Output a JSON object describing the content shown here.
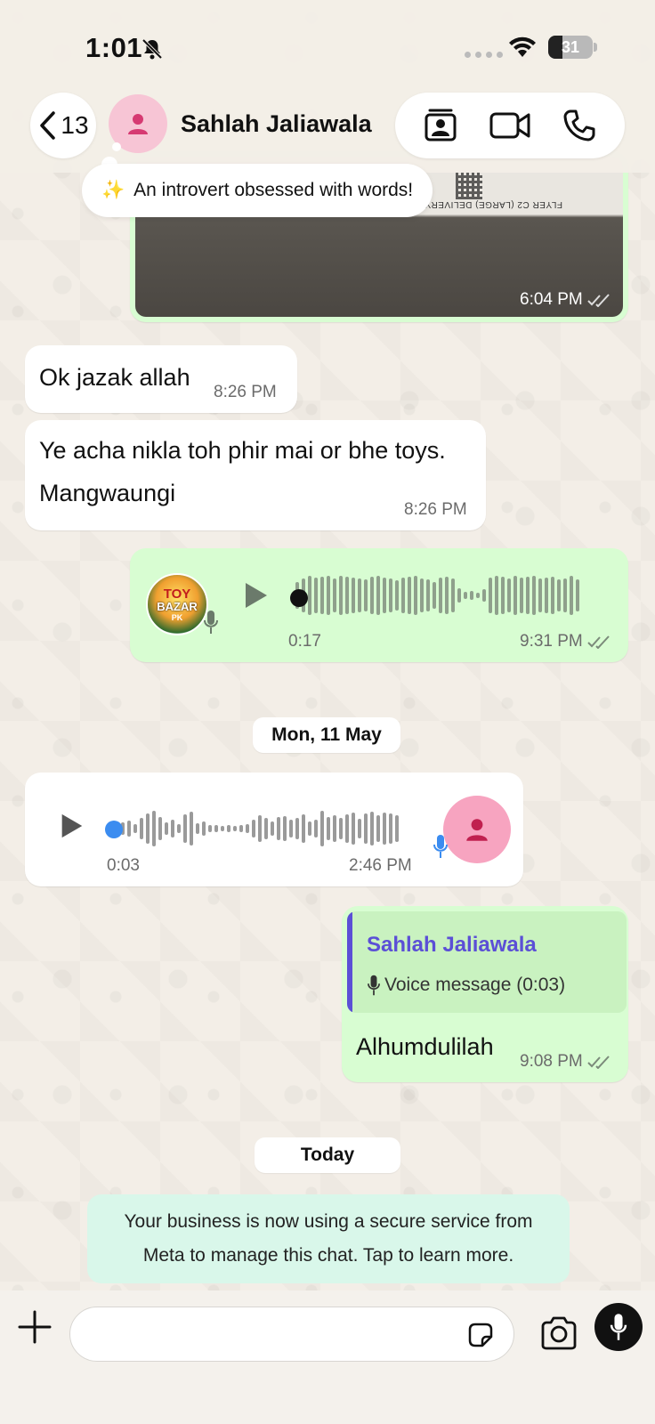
{
  "status_bar": {
    "time": "1:01",
    "battery_level": "31",
    "battery_fraction": 0.31
  },
  "header": {
    "back_count": "13",
    "contact_name": "Sahlah Jaliawala",
    "status_tip_emoji": "✨",
    "status_tip_text": "An introvert obsessed  with words!",
    "actions": [
      "contact-card-icon",
      "video-call-icon",
      "voice-call-icon"
    ]
  },
  "messages": {
    "image": {
      "time": "6:04 PM",
      "status": "read",
      "overlay_text": "FLYER C2 (LARGE) DELIVERY"
    },
    "incoming_1": {
      "text": "Ok jazak allah",
      "time": "8:26 PM"
    },
    "incoming_2": {
      "text_line1": "Ye acha nikla toh phir mai or bhe toys.",
      "text_line2": "Mangwaungi",
      "time": "8:26 PM"
    },
    "voice_out": {
      "avatar_line1": "TOY",
      "avatar_line2": "BAZAR",
      "avatar_line3": "PK",
      "duration": "0:17",
      "time": "9:31 PM",
      "progress": 0
    },
    "date_chip_1": "Mon, 11 May",
    "voice_in": {
      "duration": "0:03",
      "time": "2:46 PM",
      "progress": 0
    },
    "reply_out": {
      "quote_name": "Sahlah Jaliawala",
      "quote_text": "Voice message (0:03)",
      "text": "Alhumdulilah",
      "time": "9:08 PM"
    },
    "date_chip_2": "Today",
    "system_notice_line1": "Your business is now using a secure service from",
    "system_notice_line2": "Meta to manage this chat. Tap to learn more."
  },
  "composer": {
    "placeholder": ""
  },
  "colors": {
    "outgoing_bubble": "#d8fdd2",
    "incoming_bubble": "#ffffff",
    "read_check": "#7b8a7a",
    "quote_accent": "#5b4fd6",
    "avatar_pink": "#f7c5d5",
    "avatar_person": "#d63a72",
    "voice_progress_blue": "#3b8cf0",
    "system_notice_bg": "#d9f7ea"
  }
}
